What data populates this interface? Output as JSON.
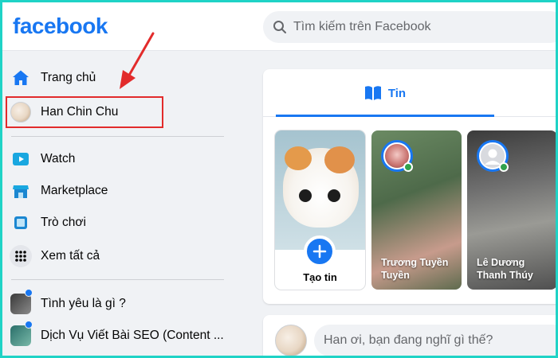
{
  "header": {
    "logo": "facebook",
    "search_placeholder": "Tìm kiếm trên Facebook"
  },
  "sidebar": {
    "items": [
      {
        "label": "Trang chủ",
        "icon": "home-icon"
      },
      {
        "label": "Han Chin Chu",
        "icon": "avatar"
      },
      {
        "label": "Watch",
        "icon": "watch-icon"
      },
      {
        "label": "Marketplace",
        "icon": "marketplace-icon"
      },
      {
        "label": "Trò chơi",
        "icon": "gaming-icon"
      },
      {
        "label": "Xem tất cả",
        "icon": "grid-icon"
      }
    ],
    "groups": [
      {
        "label": "Tình yêu là gì ?"
      },
      {
        "label": "Dịch Vụ Viết Bài SEO (Content ..."
      }
    ]
  },
  "feed": {
    "tab_label": "Tin",
    "stories": [
      {
        "label": "Tạo tin",
        "type": "create"
      },
      {
        "label": "Trương Tuyền Tuyền",
        "type": "friend"
      },
      {
        "label": "Lê Dương Thanh Thúy",
        "type": "friend"
      }
    ],
    "composer_placeholder": "Han ơi, bạn đang nghĩ gì thế?"
  },
  "colors": {
    "brand": "#1877f2",
    "annotation": "#e22b2b",
    "online": "#31a24c",
    "frame": "#1fd3c6"
  }
}
